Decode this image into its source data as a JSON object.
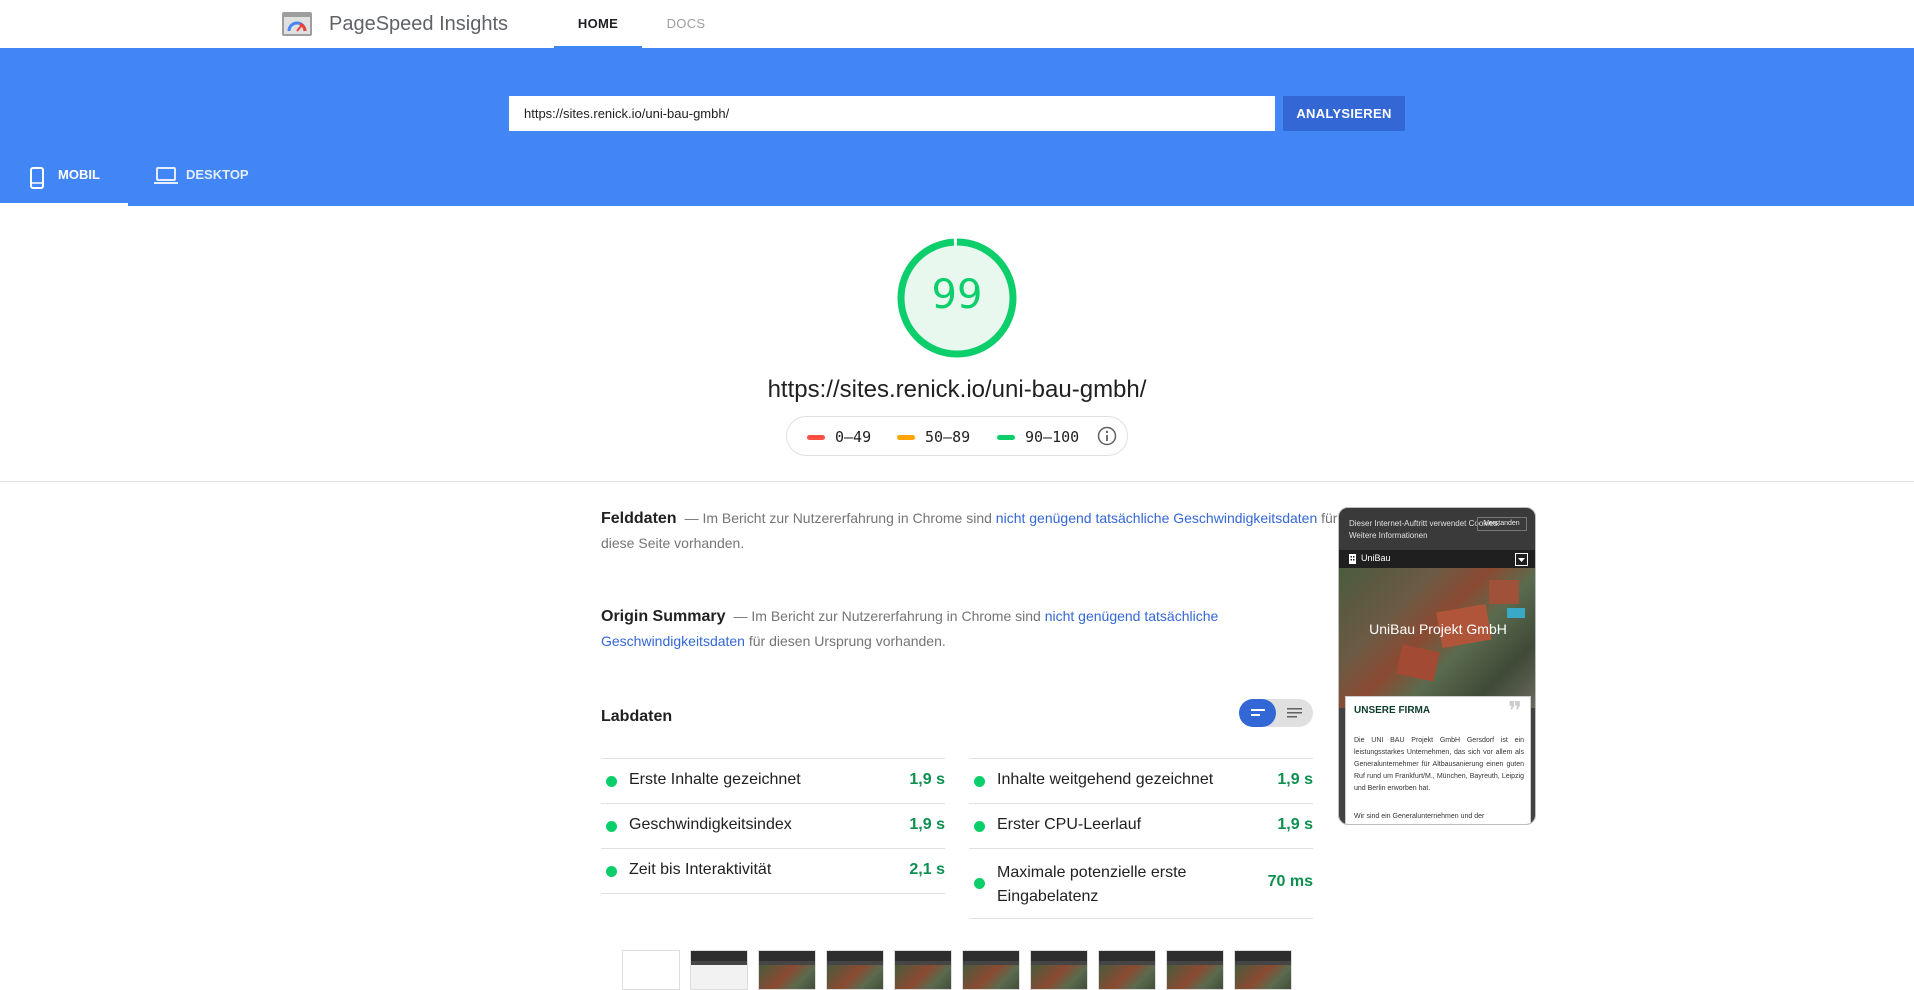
{
  "app": {
    "brand": "PageSpeed Insights",
    "nav_tabs": [
      {
        "label": "HOME",
        "active": true
      },
      {
        "label": "DOCS",
        "active": false
      }
    ]
  },
  "search": {
    "value": "https://sites.renick.io/uni-bau-gmbh/",
    "button_label": "ANALYSIEREN"
  },
  "device_tabs": [
    {
      "label": "MOBIL",
      "active": true,
      "icon": "smartphone-icon"
    },
    {
      "label": "DESKTOP",
      "active": false,
      "icon": "laptop-icon"
    }
  ],
  "score": {
    "value": "99",
    "fraction": 0.99,
    "url": "https://sites.renick.io/uni-bau-gmbh/",
    "legend": [
      {
        "range": "0–49",
        "color": "#ff4e42"
      },
      {
        "range": "50–89",
        "color": "#ffa400"
      },
      {
        "range": "90–100",
        "color": "#0cce6b"
      }
    ]
  },
  "field_data": {
    "heading": "Felddaten",
    "text_before": "— Im Bericht zur Nutzererfahrung in Chrome sind ",
    "link": "nicht genügend tatsächliche Geschwindigkeitsdaten",
    "text_after": " für diese Seite vorhanden."
  },
  "origin_summary": {
    "heading": "Origin Summary",
    "text_before": "— Im Bericht zur Nutzererfahrung in Chrome sind ",
    "link": "nicht genügend tatsächliche Geschwindigkeitsdaten",
    "text_after": " für diesen Ursprung vorhanden."
  },
  "lab_data": {
    "heading": "Labdaten",
    "metrics_left": [
      {
        "name": "Erste Inhalte gezeichnet",
        "value": "1,9 s"
      },
      {
        "name": "Geschwindigkeitsindex",
        "value": "1,9 s"
      },
      {
        "name": "Zeit bis Interaktivität",
        "value": "2,1 s"
      }
    ],
    "metrics_right": [
      {
        "name": "Inhalte weitgehend gezeichnet",
        "value": "1,9 s"
      },
      {
        "name": "Erster CPU-Leerlauf",
        "value": "1,9 s"
      },
      {
        "name": "Maximale potenzielle erste Eingabelatenz",
        "value": "70 ms"
      }
    ]
  },
  "preview": {
    "cookie_text": "Dieser Internet-Auftritt verwendet Cookies.",
    "cookie_more": "Weitere Informationen",
    "cookie_accept": "Verstanden",
    "site_name": "UniBau",
    "hero_title": "UniBau Projekt GmbH",
    "card_title": "UNSERE FIRMA",
    "card_text": "Die UNI BAU Projekt GmbH Gersdorf ist ein leistungsstarkes Unternehmen, das sich vor allem als Generalunternehmer für Altbausanierung einen guten Ruf rund um Frankfurt/M., München, Bayreuth, Leipzig und Berlin erworben hat.",
    "card_text2": "Wir sind ein Generalunternehmen und der"
  },
  "colors": {
    "accent": "#4285f4",
    "button": "#3367d6",
    "good": "#0cce6b",
    "good_text": "#0d904f"
  }
}
